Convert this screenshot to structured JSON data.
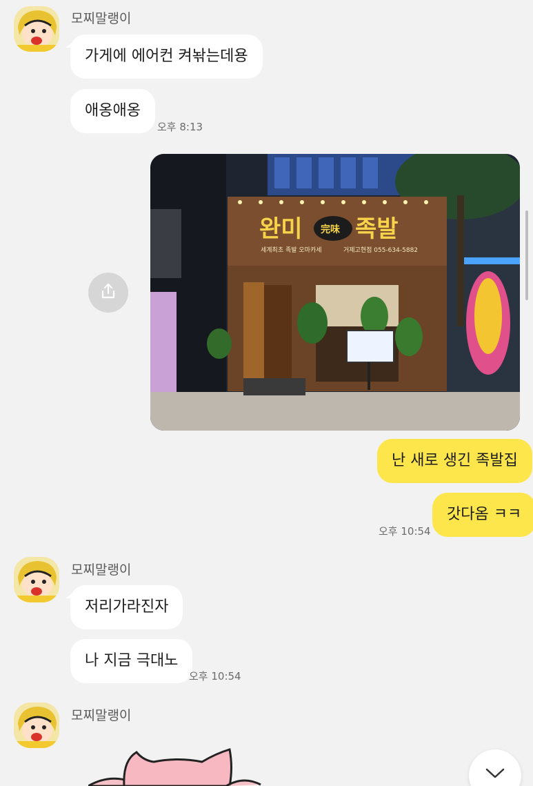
{
  "chat": {
    "sender_name": "모찌말랭이",
    "group1": {
      "msg1": "가게에 에어컨 켜놖는데용",
      "msg2": "애옹애옹",
      "time": "오후 8:13"
    },
    "photo": {
      "sign_main_left": "완미",
      "sign_badge": "完味",
      "sign_main_right": "족발",
      "sign_sub": "세계최초 족발 오마카세",
      "sign_phone": "거제고현점 055-634-5882"
    },
    "group2": {
      "msg1": "난 새로 생긴 족발집",
      "msg2": "갓다옴 ㅋㅋ",
      "time": "오후 10:54"
    },
    "group3": {
      "msg1": "저리가라진자",
      "msg2": "나 지금 극대노",
      "time": "오후 10:54"
    }
  },
  "colors": {
    "background": "#f2f2f2",
    "incoming_bubble": "#ffffff",
    "outgoing_bubble": "#fde64b"
  },
  "icons": {
    "share": "share-icon",
    "scroll_down": "chevron-down-icon"
  }
}
